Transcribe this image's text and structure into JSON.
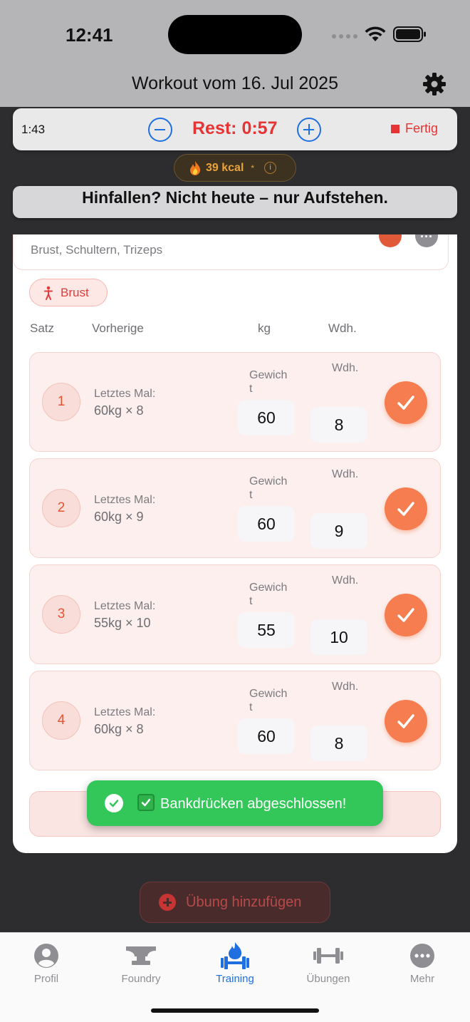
{
  "status": {
    "time": "12:41"
  },
  "header": {
    "title": "Workout vom 16. Jul 2025"
  },
  "rest_bar": {
    "elapsed": "1:43",
    "rest": "Rest: 0:57",
    "finish_label": "Fertig"
  },
  "kcal": {
    "label": "39 kcal",
    "note": "*"
  },
  "motto": "Hinfallen? Nicht heute – nur Aufstehen.",
  "exercise": {
    "muscles": "Brust, Schultern, Trizeps",
    "tag": "Brust",
    "columns": {
      "set": "Satz",
      "previous": "Vorherige",
      "kg": "kg",
      "reps": "Wdh."
    },
    "sets": [
      {
        "num": "1",
        "last_label": "Letztes Mal:",
        "last": "60kg × 8",
        "weight_label": "Gewicht",
        "weight": "60",
        "reps_label": "Wdh.",
        "reps": "8"
      },
      {
        "num": "2",
        "last_label": "Letztes Mal:",
        "last": "60kg × 9",
        "weight_label": "Gewicht",
        "weight": "60",
        "reps_label": "Wdh.",
        "reps": "9"
      },
      {
        "num": "3",
        "last_label": "Letztes Mal:",
        "last": "55kg × 10",
        "weight_label": "Gewicht",
        "weight": "55",
        "reps_label": "Wdh.",
        "reps": "10"
      },
      {
        "num": "4",
        "last_label": "Letztes Mal:",
        "last": "60kg × 8",
        "weight_label": "Gewicht",
        "weight": "60",
        "reps_label": "Wdh.",
        "reps": "8"
      }
    ]
  },
  "toast": {
    "text": "Bankdrücken abgeschlossen!"
  },
  "add_exercise": {
    "label": "Übung hinzufügen"
  },
  "tabs": [
    {
      "label": "Profil",
      "icon": "person-icon"
    },
    {
      "label": "Foundry",
      "icon": "anvil-icon"
    },
    {
      "label": "Training",
      "icon": "flame-dumbbell-icon"
    },
    {
      "label": "Übungen",
      "icon": "dumbbell-icon"
    },
    {
      "label": "Mehr",
      "icon": "more-icon"
    }
  ],
  "colors": {
    "accent": "#1f6fe0",
    "rest_red": "#e63434",
    "check_orange": "#f57d4f",
    "toast_green": "#33c759"
  }
}
